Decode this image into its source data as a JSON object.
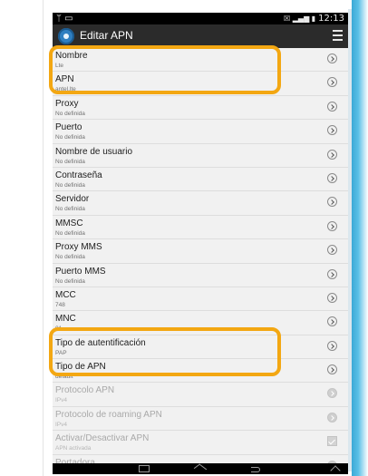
{
  "status_bar": {
    "left_icons": "ᛘ ▭",
    "right_icons": "☒ ▂▄▆ ▮",
    "time": "12:13"
  },
  "action_bar": {
    "title": "Editar APN"
  },
  "rows": [
    {
      "title": "Nombre",
      "value": "Lte",
      "state": "enabled"
    },
    {
      "title": "APN",
      "value": "antel.lte",
      "state": "enabled"
    },
    {
      "title": "Proxy",
      "value": "No definida",
      "state": "enabled"
    },
    {
      "title": "Puerto",
      "value": "No definida",
      "state": "enabled"
    },
    {
      "title": "Nombre de usuario",
      "value": "No definida",
      "state": "enabled"
    },
    {
      "title": "Contraseña",
      "value": "No definida",
      "state": "enabled"
    },
    {
      "title": "Servidor",
      "value": "No definida",
      "state": "enabled"
    },
    {
      "title": "MMSC",
      "value": "No definida",
      "state": "enabled"
    },
    {
      "title": "Proxy MMS",
      "value": "No definida",
      "state": "enabled"
    },
    {
      "title": "Puerto MMS",
      "value": "No definida",
      "state": "enabled"
    },
    {
      "title": "MCC",
      "value": "748",
      "state": "enabled"
    },
    {
      "title": "MNC",
      "value": "01",
      "state": "enabled"
    },
    {
      "title": "Tipo de autentificación",
      "value": "PAP",
      "state": "enabled"
    },
    {
      "title": "Tipo de APN",
      "value": "default",
      "state": "enabled"
    },
    {
      "title": "Protocolo APN",
      "value": "IPv4",
      "state": "disabled"
    },
    {
      "title": "Protocolo de roaming APN",
      "value": "IPv4",
      "state": "disabled"
    },
    {
      "title": "Activar/Desactivar APN",
      "value": "APN activada",
      "state": "checkbox"
    },
    {
      "title": "Portadora",
      "value": "",
      "state": "disabled"
    }
  ],
  "colors": {
    "highlight": "#f3a712",
    "action_bar": "#2b2b2b",
    "accent": "#3ba9d6"
  },
  "icons": {
    "settings": "gear-icon",
    "menu": "menu-icon",
    "row_action": "chevron-right-icon",
    "check": "checkbox-icon"
  }
}
